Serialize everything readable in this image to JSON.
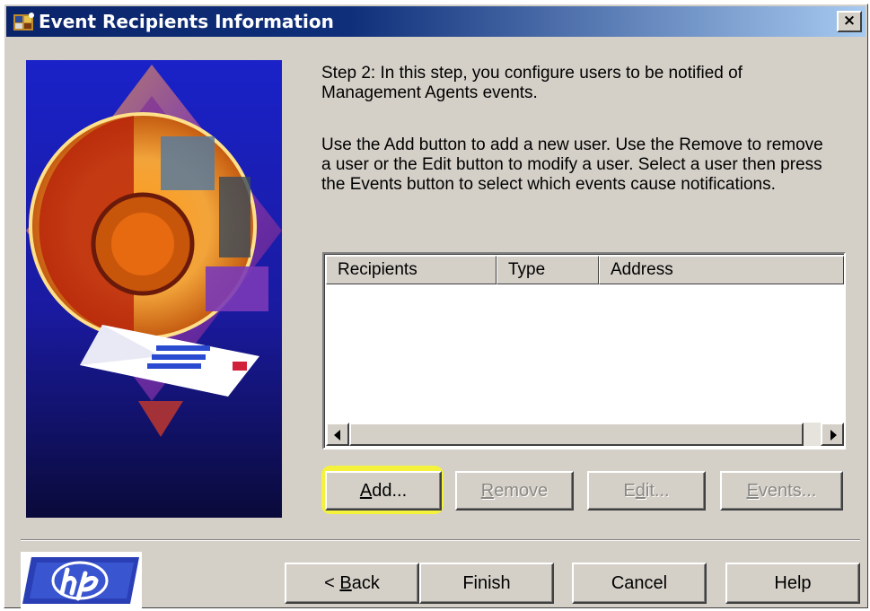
{
  "window": {
    "title": "Event Recipients Information",
    "close_label": "×"
  },
  "content": {
    "step_text": "Step 2:  In this step, you configure users to be notified of Management Agents events.",
    "info_text": "Use the Add button to add a new user. Use the Remove to remove a user or the Edit button to modify a user. Select a user then press the Events button to select which events cause notifications."
  },
  "recipients_list": {
    "columns": [
      "Recipients",
      "Type",
      "Address"
    ],
    "rows": []
  },
  "actions": {
    "add": {
      "pre": "",
      "key": "A",
      "post": "dd..."
    },
    "remove": {
      "pre": "",
      "key": "R",
      "post": "emove"
    },
    "edit": {
      "pre": "E",
      "key": "d",
      "post": "it..."
    },
    "events": {
      "pre": "",
      "key": "E",
      "post": "vents..."
    }
  },
  "nav": {
    "back": {
      "pre": "< ",
      "key": "B",
      "post": "ack"
    },
    "finish": "Finish",
    "cancel": "Cancel",
    "help": "Help"
  },
  "colors": {
    "titlebar_start": "#0a246a",
    "titlebar_end": "#a6caf0",
    "dialog_bg": "#d4d0c8",
    "highlight": "#f4f23a",
    "hp_blue": "#2a3fb5"
  },
  "icons": {
    "title": "app-gear-icon",
    "close": "close-icon",
    "scroll_left": "arrow-left-icon",
    "scroll_right": "arrow-right-icon",
    "logo": "hp-logo"
  }
}
